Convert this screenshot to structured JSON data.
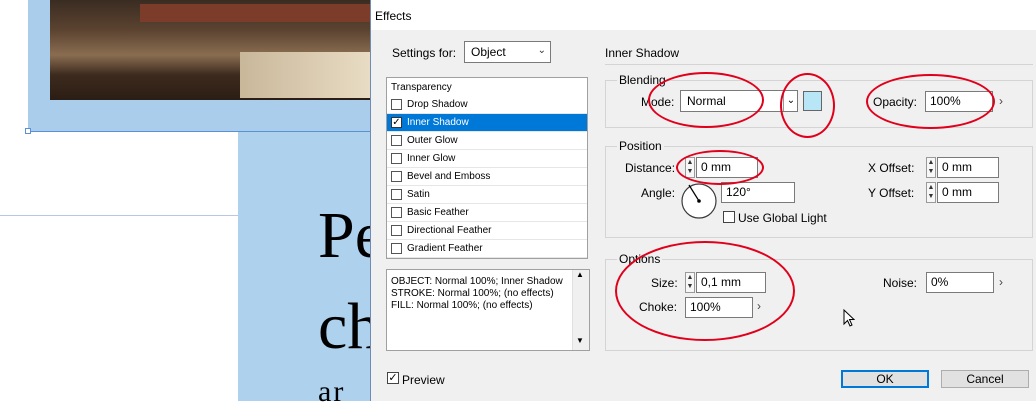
{
  "background_document": {
    "text_lines": [
      "Pe",
      "ch",
      "ar"
    ]
  },
  "dialog": {
    "title": "Effects",
    "settings_for_label": "Settings for:",
    "settings_for_value": "Object",
    "effects_list": {
      "header": "Transparency",
      "items": [
        {
          "label": "Drop Shadow",
          "checked": false,
          "selected": false
        },
        {
          "label": "Inner Shadow",
          "checked": true,
          "selected": true
        },
        {
          "label": "Outer Glow",
          "checked": false,
          "selected": false
        },
        {
          "label": "Inner Glow",
          "checked": false,
          "selected": false
        },
        {
          "label": "Bevel and Emboss",
          "checked": false,
          "selected": false
        },
        {
          "label": "Satin",
          "checked": false,
          "selected": false
        },
        {
          "label": "Basic Feather",
          "checked": false,
          "selected": false
        },
        {
          "label": "Directional Feather",
          "checked": false,
          "selected": false
        },
        {
          "label": "Gradient Feather",
          "checked": false,
          "selected": false
        }
      ]
    },
    "summary_lines": [
      "OBJECT: Normal 100%; Inner Shadow",
      "STROKE: Normal 100%; (no effects)",
      "FILL: Normal 100%; (no effects)"
    ],
    "preview_label": "Preview",
    "preview_checked": true,
    "panel_title": "Inner Shadow",
    "blending": {
      "title": "Blending",
      "mode_label": "Mode:",
      "mode_value": "Normal",
      "swatch_color": "#b9e6f7",
      "opacity_label": "Opacity:",
      "opacity_value": "100%"
    },
    "position": {
      "title": "Position",
      "distance_label": "Distance:",
      "distance_value": "0 mm",
      "angle_label": "Angle:",
      "angle_value": "120°",
      "use_global_light_label": "Use Global Light",
      "x_offset_label": "X Offset:",
      "x_offset_value": "0 mm",
      "y_offset_label": "Y Offset:",
      "y_offset_value": "0 mm"
    },
    "options": {
      "title": "Options",
      "size_label": "Size:",
      "size_value": "0,1 mm",
      "choke_label": "Choke:",
      "choke_value": "100%",
      "noise_label": "Noise:",
      "noise_value": "0%"
    },
    "ok_label": "OK",
    "cancel_label": "Cancel",
    "annotation_color": "#e0001b",
    "selection_color": "#0078d7"
  }
}
